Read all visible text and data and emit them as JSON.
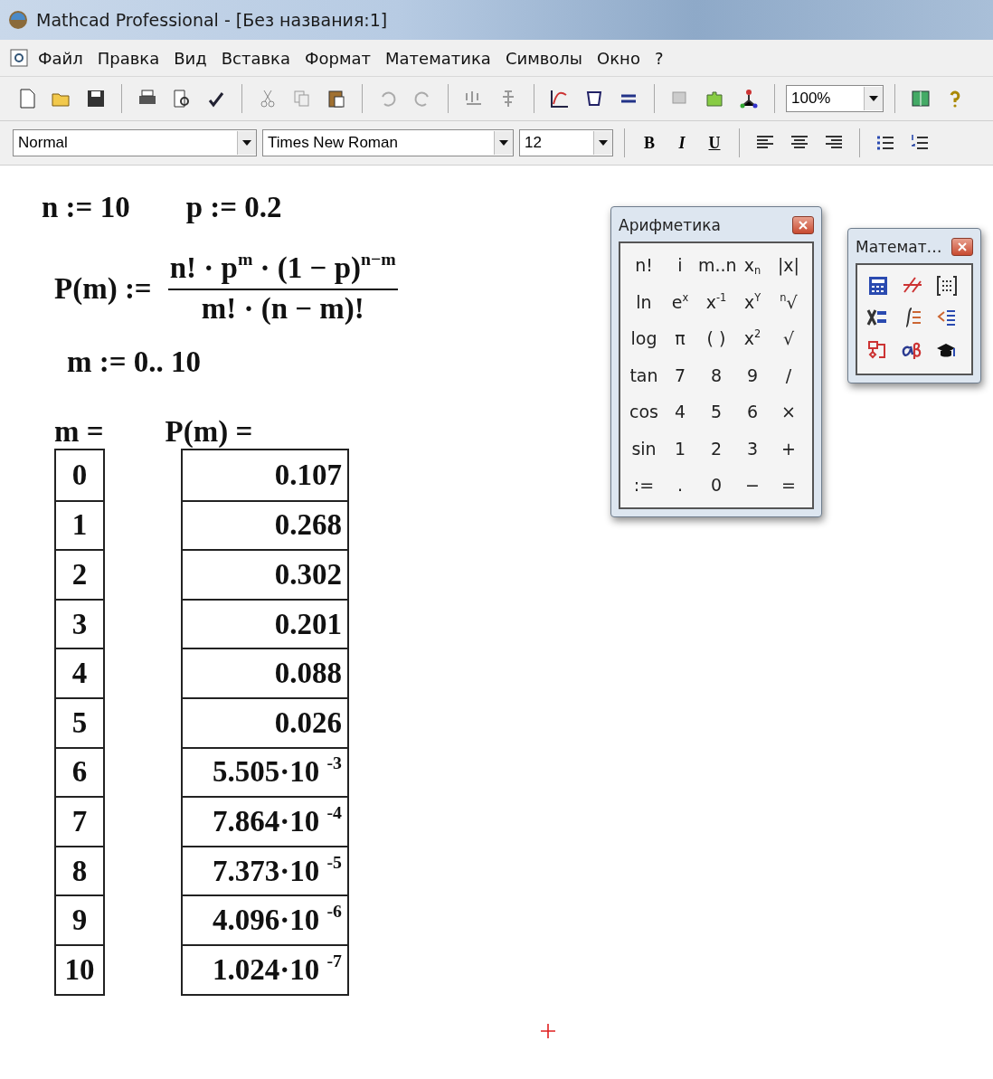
{
  "window": {
    "title": "Mathcad Professional - [Без названия:1]"
  },
  "menu": [
    "Файл",
    "Правка",
    "Вид",
    "Вставка",
    "Формат",
    "Математика",
    "Символы",
    "Окно",
    "?"
  ],
  "toolbar": {
    "zoom": "100%"
  },
  "format_bar": {
    "style": "Normal",
    "font": "Times New Roman",
    "size": "12",
    "buttons": [
      "B",
      "I",
      "U"
    ]
  },
  "worksheet": {
    "definitions": [
      "n := 10",
      "p := 0.2"
    ],
    "function": {
      "lhs": "P(m) :=",
      "numerator": "n! · p$^{m}$ · (1 − p)$^{n−m}$",
      "denominator": "m! · (n − m)!"
    },
    "range": "m := 0.. 10",
    "result_headers": [
      "m =",
      "P(m) ="
    ],
    "rows": [
      {
        "m": "0",
        "p": "0.107"
      },
      {
        "m": "1",
        "p": "0.268"
      },
      {
        "m": "2",
        "p": "0.302"
      },
      {
        "m": "3",
        "p": "0.201"
      },
      {
        "m": "4",
        "p": "0.088"
      },
      {
        "m": "5",
        "p": "0.026"
      },
      {
        "m": "6",
        "p": "5.505·10 $^{-3}$"
      },
      {
        "m": "7",
        "p": "7.864·10 $^{-4}$"
      },
      {
        "m": "8",
        "p": "7.373·10 $^{-5}$"
      },
      {
        "m": "9",
        "p": "4.096·10 $^{-6}$"
      },
      {
        "m": "10",
        "p": "1.024·10 $^{-7}$"
      }
    ]
  },
  "arithmetic_palette": {
    "title": "Арифметика",
    "keys": [
      [
        "n!",
        "i",
        "m..n",
        "x$_{n}$",
        "|x|"
      ],
      [
        "ln",
        "e$^{x}$",
        "x$^{-1}$",
        "x$^{Y}$",
        "$^{n}$√"
      ],
      [
        "log",
        "π",
        "( )",
        "x$^{2}$",
        "√"
      ],
      [
        "tan",
        "7",
        "8",
        "9",
        "/"
      ],
      [
        "cos",
        "4",
        "5",
        "6",
        "×"
      ],
      [
        "sin",
        "1",
        "2",
        "3",
        "+"
      ],
      [
        ":=",
        ".",
        "0",
        "−",
        "="
      ]
    ]
  },
  "math_palette": {
    "title": "Математ…"
  }
}
